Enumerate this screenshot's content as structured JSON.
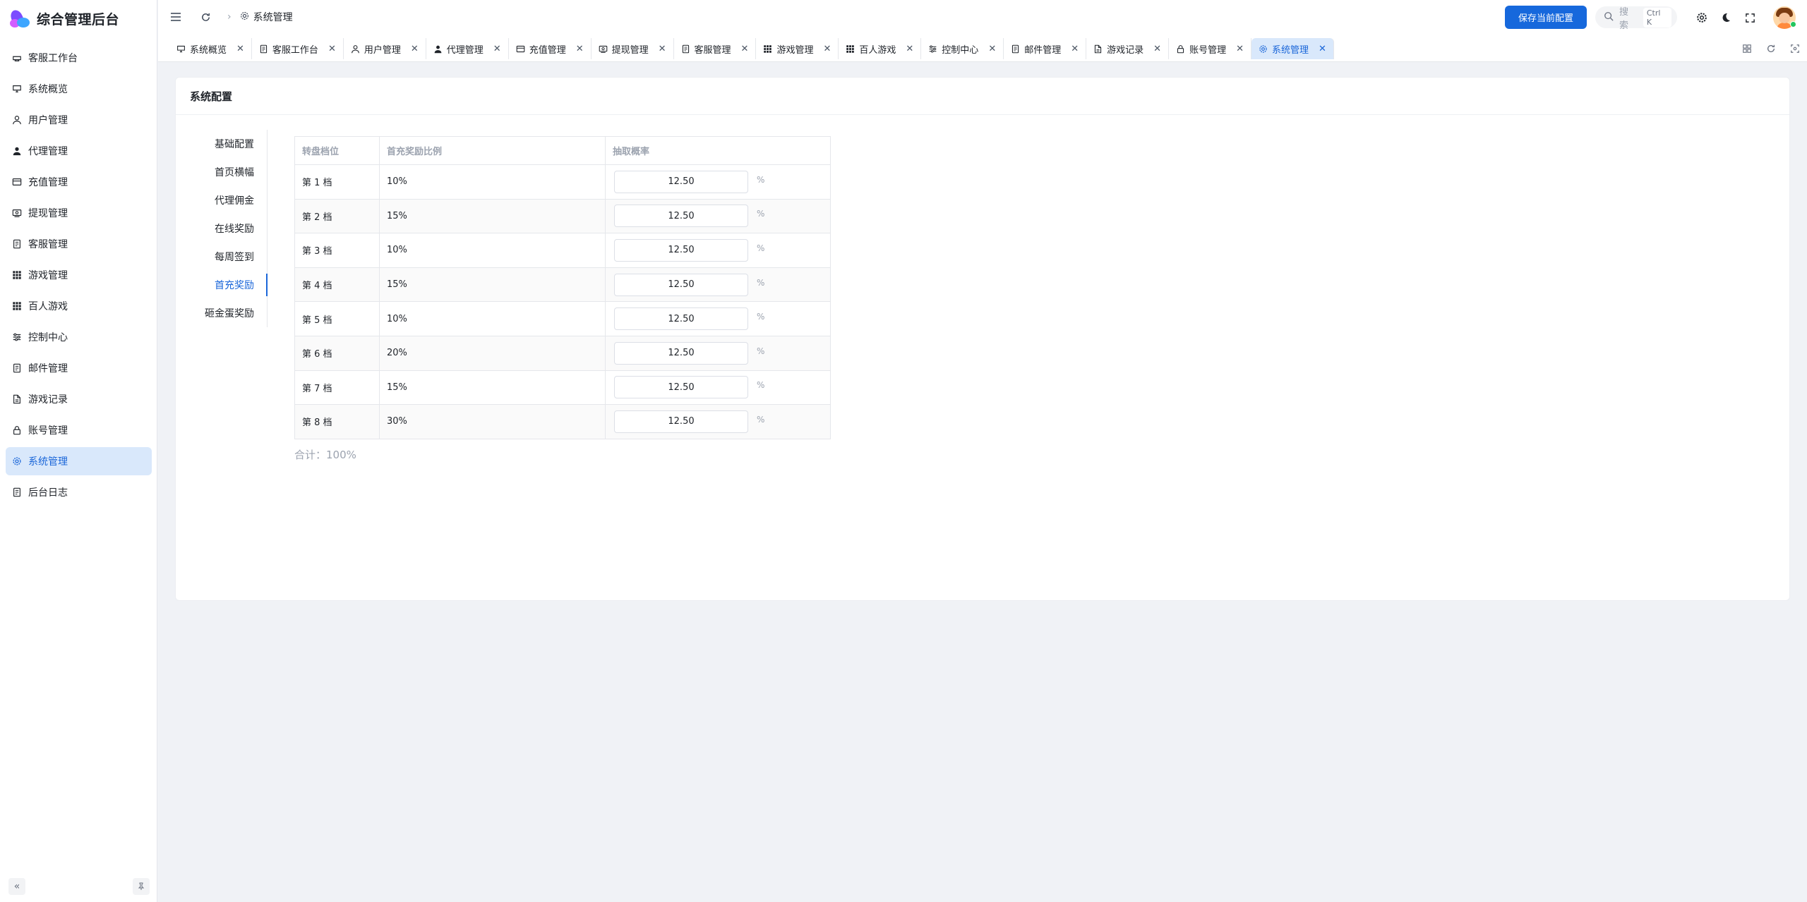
{
  "app": {
    "title": "综合管理后台"
  },
  "sidebar": {
    "items": [
      {
        "label": "客服工作台",
        "icon": "headset-icon",
        "active": false
      },
      {
        "label": "系统概览",
        "icon": "monitor-icon",
        "active": false
      },
      {
        "label": "用户管理",
        "icon": "user-icon",
        "active": false
      },
      {
        "label": "代理管理",
        "icon": "user-filled-icon",
        "active": false
      },
      {
        "label": "充值管理",
        "icon": "card-icon",
        "active": false
      },
      {
        "label": "提现管理",
        "icon": "cash-icon",
        "active": false
      },
      {
        "label": "客服管理",
        "icon": "doc-icon",
        "active": false
      },
      {
        "label": "游戏管理",
        "icon": "grid-icon",
        "active": false
      },
      {
        "label": "百人游戏",
        "icon": "grid-icon",
        "active": false
      },
      {
        "label": "控制中心",
        "icon": "sliders-icon",
        "active": false
      },
      {
        "label": "邮件管理",
        "icon": "doc-icon",
        "active": false
      },
      {
        "label": "游戏记录",
        "icon": "file-icon",
        "active": false
      },
      {
        "label": "账号管理",
        "icon": "lock-icon",
        "active": false
      },
      {
        "label": "系统管理",
        "icon": "gear-icon",
        "active": true
      },
      {
        "label": "后台日志",
        "icon": "doc-icon",
        "active": false
      }
    ]
  },
  "header": {
    "breadcrumb": "系统管理",
    "save_label": "保存当前配置",
    "search_placeholder": "搜索",
    "search_shortcut": "Ctrl K"
  },
  "tabs": [
    {
      "label": "系统概览",
      "icon": "monitor-icon",
      "active": false
    },
    {
      "label": "客服工作台",
      "icon": "doc-icon",
      "active": false
    },
    {
      "label": "用户管理",
      "icon": "user-icon",
      "active": false
    },
    {
      "label": "代理管理",
      "icon": "user-filled-icon",
      "active": false
    },
    {
      "label": "充值管理",
      "icon": "card-icon",
      "active": false
    },
    {
      "label": "提现管理",
      "icon": "cash-icon",
      "active": false
    },
    {
      "label": "客服管理",
      "icon": "doc-icon",
      "active": false
    },
    {
      "label": "游戏管理",
      "icon": "grid-icon",
      "active": false
    },
    {
      "label": "百人游戏",
      "icon": "grid-icon",
      "active": false
    },
    {
      "label": "控制中心",
      "icon": "sliders-icon",
      "active": false
    },
    {
      "label": "邮件管理",
      "icon": "doc-icon",
      "active": false
    },
    {
      "label": "游戏记录",
      "icon": "file-icon",
      "active": false
    },
    {
      "label": "账号管理",
      "icon": "lock-icon",
      "active": false
    },
    {
      "label": "系统管理",
      "icon": "gear-icon",
      "active": true
    }
  ],
  "card": {
    "title": "系统配置"
  },
  "config_nav": [
    {
      "label": "基础配置",
      "active": false
    },
    {
      "label": "首页横幅",
      "active": false
    },
    {
      "label": "代理佣金",
      "active": false
    },
    {
      "label": "在线奖励",
      "active": false
    },
    {
      "label": "每周签到",
      "active": false
    },
    {
      "label": "首充奖励",
      "active": true
    },
    {
      "label": "砸金蛋奖励",
      "active": false
    }
  ],
  "table": {
    "headers": [
      "转盘档位",
      "首充奖励比例",
      "抽取概率"
    ],
    "unit": "%",
    "rows": [
      {
        "tier": "第 1 档",
        "ratio": "10%",
        "probability": "12.50"
      },
      {
        "tier": "第 2 档",
        "ratio": "15%",
        "probability": "12.50"
      },
      {
        "tier": "第 3 档",
        "ratio": "10%",
        "probability": "12.50"
      },
      {
        "tier": "第 4 档",
        "ratio": "15%",
        "probability": "12.50"
      },
      {
        "tier": "第 5 档",
        "ratio": "10%",
        "probability": "12.50"
      },
      {
        "tier": "第 6 档",
        "ratio": "20%",
        "probability": "12.50"
      },
      {
        "tier": "第 7 档",
        "ratio": "15%",
        "probability": "12.50"
      },
      {
        "tier": "第 8 档",
        "ratio": "30%",
        "probability": "12.50"
      }
    ],
    "total_label": "合计：100%"
  },
  "colors": {
    "primary": "#1668dc",
    "active_bg": "#d9e8fb",
    "page_bg": "#f0f2f6"
  }
}
